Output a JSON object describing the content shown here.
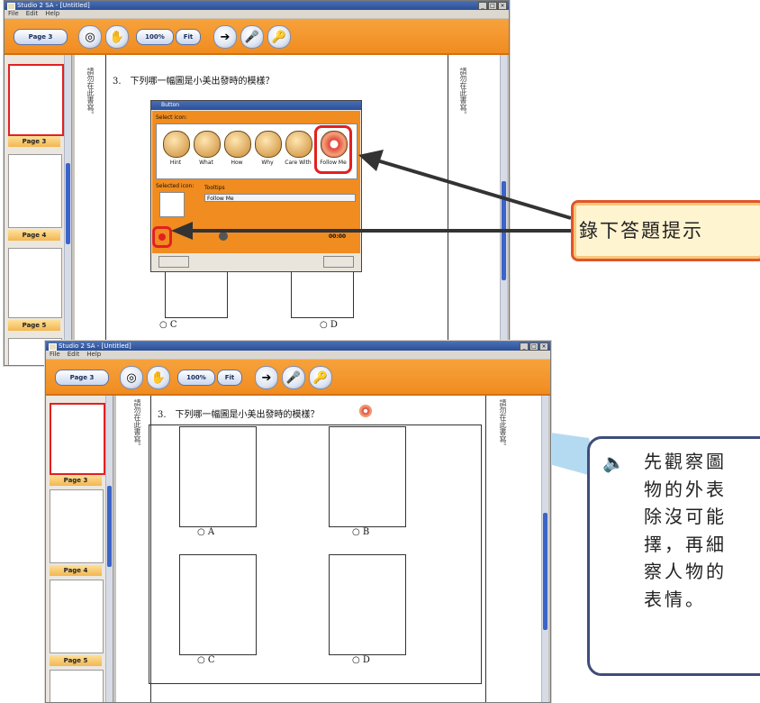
{
  "top_window": {
    "title": "Studio 2 SA - [Untitled]",
    "menu": [
      "File",
      "Edit",
      "Help"
    ],
    "toolbar": {
      "page_pill": "Page 3",
      "zoom": "100%",
      "fit": "Fit"
    },
    "thumbs": [
      "Page 3",
      "Page 4",
      "Page 5"
    ],
    "question": "3.　下列哪一幅圖是小美出發時的模樣？",
    "vertical_left": "請勿在此書寫。",
    "vertical_right": "請勿在此書寫。",
    "options": [
      "○ C",
      "○ D"
    ]
  },
  "dialog": {
    "title": "Button",
    "select_icon_label": "Select icon:",
    "icons": [
      "Hint",
      "What",
      "How",
      "Why",
      "Care With",
      "Follow Me"
    ],
    "selected_icon_label": "Selected icon:",
    "tooltips_label": "Tooltips",
    "tooltip_value": "Follow Me",
    "time": "00:00"
  },
  "bottom_window": {
    "title": "Studio 2 SA - [Untitled]",
    "menu": [
      "File",
      "Edit",
      "Help"
    ],
    "toolbar": {
      "page_pill": "Page 3",
      "zoom": "100%",
      "fit": "Fit"
    },
    "thumbs": [
      "Page 3",
      "Page 4",
      "Page 5"
    ],
    "question": "3.　下列哪一幅圖是小美出發時的模樣？",
    "vertical_left": "請勿在此書寫。",
    "vertical_right": "請勿在此書寫。",
    "options": [
      "○ A",
      "○ B",
      "○ C",
      "○ D"
    ]
  },
  "callout": {
    "text": "錄下答題提示"
  },
  "tip": {
    "text": "先觀察圖\n物的外表\n除沒可能\n擇，再細\n察人物的\n表情。"
  },
  "colors": {
    "toolbar_orange": "#f08c20",
    "callout_border": "#e2542a",
    "tip_border": "#3e4d7a",
    "highlight_red": "#e22020"
  }
}
